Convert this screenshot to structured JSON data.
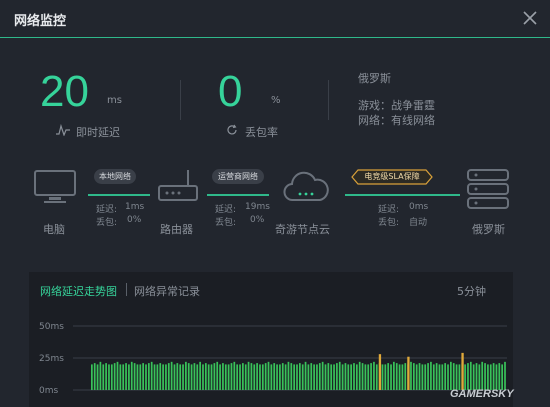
{
  "window": {
    "title": "网络监控"
  },
  "latency": {
    "value": "20",
    "unit": "ms",
    "label": "即时延迟"
  },
  "packet_loss": {
    "value": "0",
    "unit": "%",
    "label": "丢包率"
  },
  "server": {
    "region": "俄罗斯",
    "game_line": "游戏：战争雷霆",
    "network_line": "网络：有线网络"
  },
  "path": {
    "nodes": {
      "pc": "电脑",
      "router": "路由器",
      "cloud": "奇游节点云",
      "server": "俄罗斯"
    },
    "links": [
      {
        "badge": "本地网络",
        "delay_label": "延迟:",
        "delay": "1ms",
        "loss_label": "丢包:",
        "loss": "0%"
      },
      {
        "badge": "运营商网络",
        "delay_label": "延迟:",
        "delay": "19ms",
        "loss_label": "丢包:",
        "loss": "0%"
      },
      {
        "badge": "电竞级SLA保障",
        "delay_label": "延迟:",
        "delay": "0ms",
        "loss_label": "丢包:",
        "loss": "自动"
      }
    ]
  },
  "chart_panel": {
    "tab_active": "网络延迟走势图",
    "tab_inactive": "网络异常记录",
    "range": "5分钟"
  },
  "watermark": "GAMERSKY",
  "colors": {
    "accent": "#36d39a",
    "bar": "#39c25a",
    "spike": "#e0a93a"
  },
  "chart_data": {
    "type": "bar",
    "ylim": [
      0,
      50
    ],
    "y_ticks": [
      "50ms",
      "25ms",
      "0ms"
    ],
    "values": [
      20,
      21,
      20,
      22,
      20,
      21,
      20,
      20,
      21,
      22,
      20,
      20,
      21,
      20,
      22,
      21,
      20,
      20,
      21,
      20,
      21,
      22,
      20,
      20,
      21,
      20,
      20,
      21,
      22,
      20,
      21,
      20,
      20,
      22,
      21,
      20,
      21,
      20,
      22,
      20,
      21,
      20,
      20,
      21,
      22,
      20,
      21,
      20,
      20,
      21,
      22,
      20,
      20,
      21,
      20,
      22,
      21,
      20,
      21,
      20,
      20,
      21,
      22,
      20,
      21,
      20,
      20,
      21,
      20,
      22,
      21,
      20,
      20,
      21,
      20,
      22,
      20,
      21,
      20,
      20,
      21,
      22,
      20,
      21,
      20,
      20,
      21,
      22,
      20,
      21,
      20,
      20,
      21,
      20,
      22,
      21,
      20,
      20,
      21,
      22,
      20,
      21,
      20,
      20,
      21,
      20,
      22,
      21,
      20,
      20,
      21,
      20,
      22,
      21,
      20,
      21,
      20,
      20,
      21,
      22,
      20,
      21,
      20,
      20,
      21,
      20,
      22,
      21,
      20,
      20,
      21,
      20,
      21,
      22,
      20,
      21,
      20,
      22,
      21,
      20,
      20,
      21,
      20,
      21,
      20,
      22
    ],
    "spikes": [
      {
        "index": 101,
        "value": 28
      },
      {
        "index": 111,
        "value": 26
      },
      {
        "index": 130,
        "value": 29
      }
    ]
  }
}
